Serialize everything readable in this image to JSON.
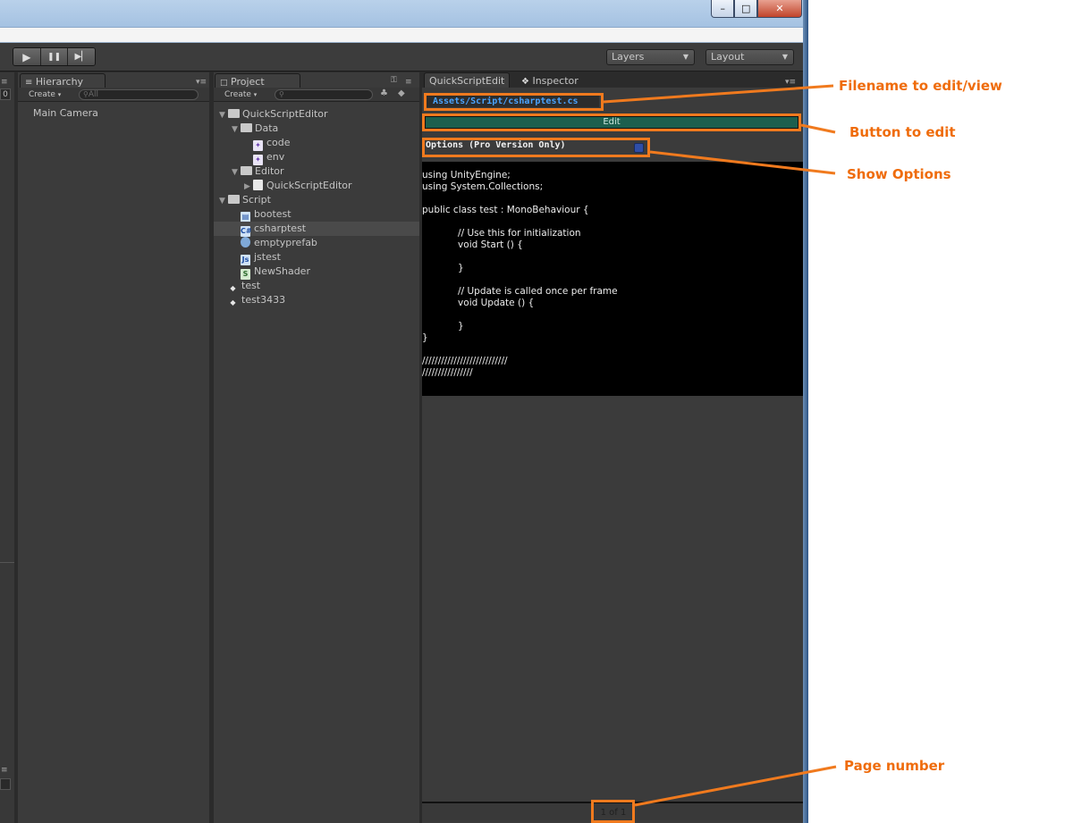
{
  "window": {
    "minimize_glyph": "–",
    "maximize_glyph": "□",
    "close_glyph": "✕"
  },
  "toolbar": {
    "play_glyph": "▶",
    "pause_glyph": "❚❚",
    "step_glyph": "▶▏",
    "layers_label": "Layers",
    "layout_label": "Layout",
    "arrow_glyph": "▼"
  },
  "left_stub": {
    "count": "0"
  },
  "hierarchy": {
    "tab_label": "Hierarchy",
    "create_label": "Create",
    "search_placeholder": "All",
    "items": [
      "Main Camera"
    ]
  },
  "project": {
    "tab_label": "Project",
    "create_label": "Create",
    "tree": [
      {
        "label": "QuickScriptEditor",
        "indent": 0,
        "kind": "folder",
        "expanded": true
      },
      {
        "label": "Data",
        "indent": 1,
        "kind": "folder",
        "expanded": true
      },
      {
        "label": "code",
        "indent": 2,
        "kind": "vs"
      },
      {
        "label": "env",
        "indent": 2,
        "kind": "vs"
      },
      {
        "label": "Editor",
        "indent": 1,
        "kind": "folder",
        "expanded": true
      },
      {
        "label": "QuickScriptEditor",
        "indent": 2,
        "kind": "file",
        "collapsed": true
      },
      {
        "label": "Script",
        "indent": 0,
        "kind": "folder",
        "expanded": true
      },
      {
        "label": "bootest",
        "indent": 1,
        "kind": "boo"
      },
      {
        "label": "csharptest",
        "indent": 1,
        "kind": "cs",
        "selected": true
      },
      {
        "label": "emptyprefab",
        "indent": 1,
        "kind": "prefab"
      },
      {
        "label": "jstest",
        "indent": 1,
        "kind": "js"
      },
      {
        "label": "NewShader",
        "indent": 1,
        "kind": "shader"
      },
      {
        "label": "test",
        "indent": 0,
        "kind": "unity"
      },
      {
        "label": "test3433",
        "indent": 0,
        "kind": "unity"
      }
    ]
  },
  "quickscript": {
    "tab_label": "QuickScriptEdit",
    "inspector_label": "Inspector",
    "filename": "Assets/Script/csharptest.cs",
    "edit_label": "Edit",
    "options_label": "Options (Pro Version Only)",
    "code_lines": [
      "using UnityEngine;",
      "using System.Collections;",
      "",
      "public class test : MonoBehaviour {",
      "",
      "            // Use this for initialization",
      "            void Start () {",
      "",
      "            }",
      "",
      "            // Update is called once per frame",
      "            void Update () {",
      "",
      "            }",
      "}",
      "",
      "///////////////////////////",
      "////////////////"
    ],
    "page_number": "1 of 1"
  },
  "annotations": {
    "filename": "Filename to edit/view",
    "edit": "Button to edit",
    "options": "Show Options",
    "page": "Page number"
  },
  "colors": {
    "accent": "#f07a1e",
    "filename_text": "#4ba4ff",
    "edit_button": "#1c5f4e"
  }
}
